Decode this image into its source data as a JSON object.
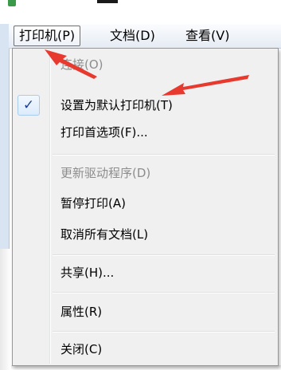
{
  "menu_bar": {
    "items": [
      {
        "label": "打印机(P)"
      },
      {
        "label": "文档(D)"
      },
      {
        "label": "查看(V)"
      }
    ]
  },
  "dropdown": {
    "items": [
      {
        "label": "连接(O)"
      },
      {
        "label": "设置为默认打印机(T)",
        "check_mark": "✓"
      },
      {
        "label": "打印首选项(F)..."
      },
      {
        "label": "更新驱动程序(D)"
      },
      {
        "label": "暂停打印(A)"
      },
      {
        "label": "取消所有文档(L)"
      },
      {
        "label": "共享(H)..."
      },
      {
        "label": "属性(R)"
      },
      {
        "label": "关闭(C)"
      }
    ]
  },
  "colors": {
    "annotation_arrow": "#e8392f",
    "menu_background": "#f0f0f0",
    "disabled_text": "#8d8d8d"
  },
  "icons": {
    "window_icon": "printer-window-icon",
    "check_mark": "check-icon"
  }
}
